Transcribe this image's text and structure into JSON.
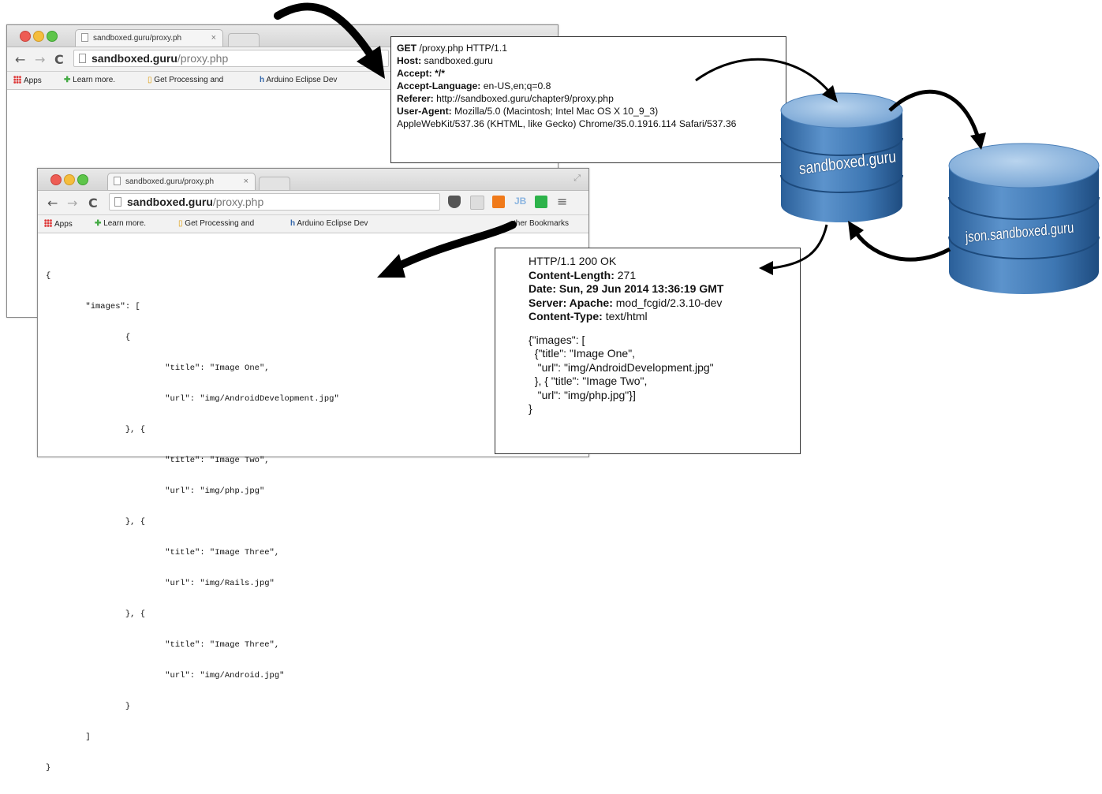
{
  "back_browser": {
    "tab_title": "sandboxed.guru/proxy.ph",
    "url_domain": "sandboxed.guru",
    "url_path": "/proxy.php",
    "bookmarks": [
      "Apps",
      "Learn more.",
      "Get Processing and",
      "Arduino Eclipse Dev"
    ]
  },
  "front_browser": {
    "tab_title": "sandboxed.guru/proxy.ph",
    "url_domain": "sandboxed.guru",
    "url_path": "/proxy.php",
    "bookmarks": [
      "Apps",
      "Learn more.",
      "Get Processing and",
      "Arduino Eclipse Dev",
      "ther Bookmarks"
    ],
    "code_lines": [
      "{",
      "        \"images\": [",
      "                {",
      "                        \"title\": \"Image One\",",
      "                        \"url\": \"img/AndroidDevelopment.jpg\"",
      "                }, {",
      "                        \"title\": \"Image Two\",",
      "                        \"url\": \"img/php.jpg\"",
      "                }, {",
      "                        \"title\": \"Image Three\",",
      "                        \"url\": \"img/Rails.jpg\"",
      "                }, {",
      "                        \"title\": \"Image Three\",",
      "                        \"url\": \"img/Android.jpg\"",
      "                }",
      "        ]",
      "}"
    ]
  },
  "request": {
    "line1_method": "GET",
    "line1_rest": " /proxy.php HTTP/1.1",
    "host_label": "Host:",
    "host_value": " sandboxed.guru",
    "accept_label": "Accept: */*",
    "lang_label": "Accept-Language:",
    "lang_value": " en-US,en;q=0.8",
    "referer_label": "Referer:",
    "referer_value": " http://sandboxed.guru/chapter9/proxy.php",
    "ua_label": "User-Agent:",
    "ua_value": " Mozilla/5.0 (Macintosh; Intel Mac OS X 10_9_3)",
    "ua_cont": "AppleWebKit/537.36 (KHTML, like Gecko)  Chrome/35.0.1916.114 Safari/537.36"
  },
  "response": {
    "status": "HTTP/1.1 200 OK",
    "cl_label": "Content-Length:",
    "cl_value": " 271",
    "date_label": "Date: Sun, 29 Jun 2014 13:36:19 GMT",
    "server_label": "Server: Apache:",
    "server_value": " mod_fcgid/2.3.10-dev",
    "ct_label": "Content-Type:",
    "ct_value": " text/html",
    "body_lines": [
      "{\"images\": [",
      "  {\"title\": \"Image One\",",
      "   \"url\": \"img/AndroidDevelopment.jpg\"",
      "  }, { \"title\": \"Image Two\",",
      "   \"url\": \"img/php.jpg\"}]",
      "}"
    ]
  },
  "servers": {
    "primary": "sandboxed.guru",
    "secondary": "json.sandboxed.guru"
  },
  "colors": {
    "db_top": "#8fb7de",
    "db_body": "#3f78b4",
    "arrow": "#000000"
  }
}
